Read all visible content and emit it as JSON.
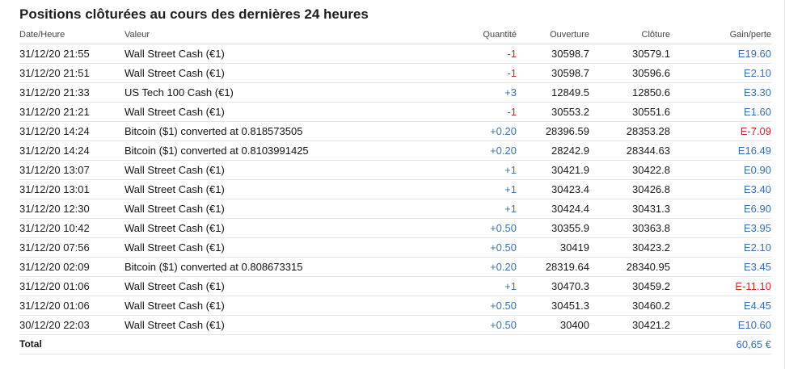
{
  "title": "Positions clôturées au cours des dernières 24 heures",
  "headers": {
    "date": "Date/Heure",
    "instrument": "Valeur",
    "quantity": "Quantité",
    "open": "Ouverture",
    "close": "Clôture",
    "pl": "Gain/perte"
  },
  "colors": {
    "negative": "#c62828",
    "positive": "#3a6fb0"
  },
  "rows": [
    {
      "date": "31/12/20 21:55",
      "instrument": "Wall Street Cash (€1)",
      "quantity": "-1",
      "qty_sign": "neg",
      "open": "30598.7",
      "close": "30579.1",
      "pl": "E19.60",
      "pl_sign": "pos"
    },
    {
      "date": "31/12/20 21:51",
      "instrument": "Wall Street Cash (€1)",
      "quantity": "-1",
      "qty_sign": "neg",
      "open": "30598.7",
      "close": "30596.6",
      "pl": "E2.10",
      "pl_sign": "pos"
    },
    {
      "date": "31/12/20 21:33",
      "instrument": "US Tech 100 Cash (€1)",
      "quantity": "+3",
      "qty_sign": "pos",
      "open": "12849.5",
      "close": "12850.6",
      "pl": "E3.30",
      "pl_sign": "pos"
    },
    {
      "date": "31/12/20 21:21",
      "instrument": "Wall Street Cash (€1)",
      "quantity": "-1",
      "qty_sign": "neg",
      "open": "30553.2",
      "close": "30551.6",
      "pl": "E1.60",
      "pl_sign": "pos"
    },
    {
      "date": "31/12/20 14:24",
      "instrument": "Bitcoin ($1) converted at 0.818573505",
      "quantity": "+0.20",
      "qty_sign": "pos",
      "open": "28396.59",
      "close": "28353.28",
      "pl": "E-7.09",
      "pl_sign": "neg"
    },
    {
      "date": "31/12/20 14:24",
      "instrument": "Bitcoin ($1) converted at 0.8103991425",
      "quantity": "+0.20",
      "qty_sign": "pos",
      "open": "28242.9",
      "close": "28344.63",
      "pl": "E16.49",
      "pl_sign": "pos"
    },
    {
      "date": "31/12/20 13:07",
      "instrument": "Wall Street Cash (€1)",
      "quantity": "+1",
      "qty_sign": "pos",
      "open": "30421.9",
      "close": "30422.8",
      "pl": "E0.90",
      "pl_sign": "pos"
    },
    {
      "date": "31/12/20 13:01",
      "instrument": "Wall Street Cash (€1)",
      "quantity": "+1",
      "qty_sign": "pos",
      "open": "30423.4",
      "close": "30426.8",
      "pl": "E3.40",
      "pl_sign": "pos"
    },
    {
      "date": "31/12/20 12:30",
      "instrument": "Wall Street Cash (€1)",
      "quantity": "+1",
      "qty_sign": "pos",
      "open": "30424.4",
      "close": "30431.3",
      "pl": "E6.90",
      "pl_sign": "pos"
    },
    {
      "date": "31/12/20 10:42",
      "instrument": "Wall Street Cash (€1)",
      "quantity": "+0.50",
      "qty_sign": "pos",
      "open": "30355.9",
      "close": "30363.8",
      "pl": "E3.95",
      "pl_sign": "pos"
    },
    {
      "date": "31/12/20 07:56",
      "instrument": "Wall Street Cash (€1)",
      "quantity": "+0.50",
      "qty_sign": "pos",
      "open": "30419",
      "close": "30423.2",
      "pl": "E2.10",
      "pl_sign": "pos"
    },
    {
      "date": "31/12/20 02:09",
      "instrument": "Bitcoin ($1) converted at 0.808673315",
      "quantity": "+0.20",
      "qty_sign": "pos",
      "open": "28319.64",
      "close": "28340.95",
      "pl": "E3.45",
      "pl_sign": "pos"
    },
    {
      "date": "31/12/20 01:06",
      "instrument": "Wall Street Cash (€1)",
      "quantity": "+1",
      "qty_sign": "pos",
      "open": "30470.3",
      "close": "30459.2",
      "pl": "E-11.10",
      "pl_sign": "neg"
    },
    {
      "date": "31/12/20 01:06",
      "instrument": "Wall Street Cash (€1)",
      "quantity": "+0.50",
      "qty_sign": "pos",
      "open": "30451.3",
      "close": "30460.2",
      "pl": "E4.45",
      "pl_sign": "pos"
    },
    {
      "date": "30/12/20 22:03",
      "instrument": "Wall Street Cash (€1)",
      "quantity": "+0.50",
      "qty_sign": "pos",
      "open": "30400",
      "close": "30421.2",
      "pl": "E10.60",
      "pl_sign": "pos"
    }
  ],
  "total": {
    "label": "Total",
    "value": "60,65 €"
  }
}
